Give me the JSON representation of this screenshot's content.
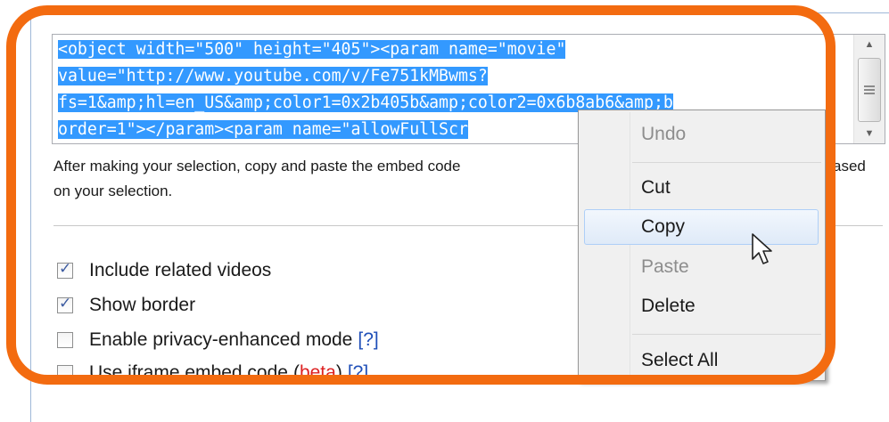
{
  "embed_code": {
    "lines": [
      "<object width=\"500\" height=\"405\"><param name=\"movie\"",
      "value=\"http://www.youtube.com/v/Fe751kMBwms?",
      "fs=1&amp;hl=en_US&amp;color1=0x2b405b&amp;color2=0x6b8ab6&amp;b",
      "order=1\"></param><param name=\"allowFullScr"
    ]
  },
  "instructions": {
    "part1": "After making your selection, copy and paste the embed code",
    "part2": "ased",
    "line2": "on your selection."
  },
  "options": [
    {
      "label": "Include related videos",
      "checked": true
    },
    {
      "label": "Show border",
      "checked": true
    },
    {
      "label": "Enable privacy-enhanced mode",
      "help": "[?]",
      "checked": false
    },
    {
      "label": "Use iframe embed code",
      "beta_open": "(",
      "beta": "beta",
      "beta_close": ")",
      "help": "[?]",
      "checked": false
    }
  ],
  "context_menu": {
    "undo": "Undo",
    "cut": "Cut",
    "copy": "Copy",
    "paste": "Paste",
    "delete": "Delete",
    "select_all": "Select All"
  },
  "icons": {
    "scroll_up": "triangle-up",
    "scroll_down": "triangle-down",
    "cursor": "arrow-pointer"
  },
  "colors": {
    "selection": "#3399ff",
    "highlight_ring": "#f36b10",
    "link": "#1f4fb8",
    "beta": "#dd2222"
  }
}
